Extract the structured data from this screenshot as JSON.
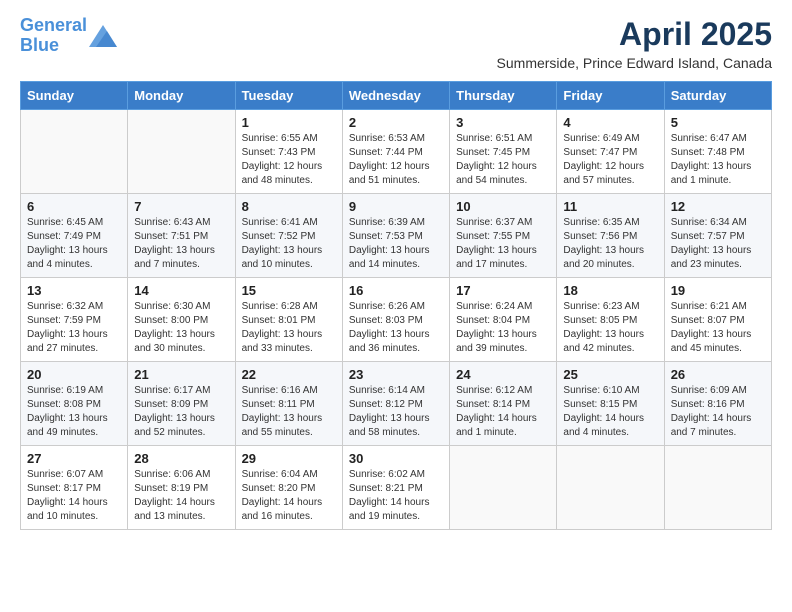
{
  "header": {
    "logo_line1": "General",
    "logo_line2": "Blue",
    "month_title": "April 2025",
    "subtitle": "Summerside, Prince Edward Island, Canada"
  },
  "days_of_week": [
    "Sunday",
    "Monday",
    "Tuesday",
    "Wednesday",
    "Thursday",
    "Friday",
    "Saturday"
  ],
  "weeks": [
    [
      {
        "day": "",
        "info": ""
      },
      {
        "day": "",
        "info": ""
      },
      {
        "day": "1",
        "info": "Sunrise: 6:55 AM\nSunset: 7:43 PM\nDaylight: 12 hours\nand 48 minutes."
      },
      {
        "day": "2",
        "info": "Sunrise: 6:53 AM\nSunset: 7:44 PM\nDaylight: 12 hours\nand 51 minutes."
      },
      {
        "day": "3",
        "info": "Sunrise: 6:51 AM\nSunset: 7:45 PM\nDaylight: 12 hours\nand 54 minutes."
      },
      {
        "day": "4",
        "info": "Sunrise: 6:49 AM\nSunset: 7:47 PM\nDaylight: 12 hours\nand 57 minutes."
      },
      {
        "day": "5",
        "info": "Sunrise: 6:47 AM\nSunset: 7:48 PM\nDaylight: 13 hours\nand 1 minute."
      }
    ],
    [
      {
        "day": "6",
        "info": "Sunrise: 6:45 AM\nSunset: 7:49 PM\nDaylight: 13 hours\nand 4 minutes."
      },
      {
        "day": "7",
        "info": "Sunrise: 6:43 AM\nSunset: 7:51 PM\nDaylight: 13 hours\nand 7 minutes."
      },
      {
        "day": "8",
        "info": "Sunrise: 6:41 AM\nSunset: 7:52 PM\nDaylight: 13 hours\nand 10 minutes."
      },
      {
        "day": "9",
        "info": "Sunrise: 6:39 AM\nSunset: 7:53 PM\nDaylight: 13 hours\nand 14 minutes."
      },
      {
        "day": "10",
        "info": "Sunrise: 6:37 AM\nSunset: 7:55 PM\nDaylight: 13 hours\nand 17 minutes."
      },
      {
        "day": "11",
        "info": "Sunrise: 6:35 AM\nSunset: 7:56 PM\nDaylight: 13 hours\nand 20 minutes."
      },
      {
        "day": "12",
        "info": "Sunrise: 6:34 AM\nSunset: 7:57 PM\nDaylight: 13 hours\nand 23 minutes."
      }
    ],
    [
      {
        "day": "13",
        "info": "Sunrise: 6:32 AM\nSunset: 7:59 PM\nDaylight: 13 hours\nand 27 minutes."
      },
      {
        "day": "14",
        "info": "Sunrise: 6:30 AM\nSunset: 8:00 PM\nDaylight: 13 hours\nand 30 minutes."
      },
      {
        "day": "15",
        "info": "Sunrise: 6:28 AM\nSunset: 8:01 PM\nDaylight: 13 hours\nand 33 minutes."
      },
      {
        "day": "16",
        "info": "Sunrise: 6:26 AM\nSunset: 8:03 PM\nDaylight: 13 hours\nand 36 minutes."
      },
      {
        "day": "17",
        "info": "Sunrise: 6:24 AM\nSunset: 8:04 PM\nDaylight: 13 hours\nand 39 minutes."
      },
      {
        "day": "18",
        "info": "Sunrise: 6:23 AM\nSunset: 8:05 PM\nDaylight: 13 hours\nand 42 minutes."
      },
      {
        "day": "19",
        "info": "Sunrise: 6:21 AM\nSunset: 8:07 PM\nDaylight: 13 hours\nand 45 minutes."
      }
    ],
    [
      {
        "day": "20",
        "info": "Sunrise: 6:19 AM\nSunset: 8:08 PM\nDaylight: 13 hours\nand 49 minutes."
      },
      {
        "day": "21",
        "info": "Sunrise: 6:17 AM\nSunset: 8:09 PM\nDaylight: 13 hours\nand 52 minutes."
      },
      {
        "day": "22",
        "info": "Sunrise: 6:16 AM\nSunset: 8:11 PM\nDaylight: 13 hours\nand 55 minutes."
      },
      {
        "day": "23",
        "info": "Sunrise: 6:14 AM\nSunset: 8:12 PM\nDaylight: 13 hours\nand 58 minutes."
      },
      {
        "day": "24",
        "info": "Sunrise: 6:12 AM\nSunset: 8:14 PM\nDaylight: 14 hours\nand 1 minute."
      },
      {
        "day": "25",
        "info": "Sunrise: 6:10 AM\nSunset: 8:15 PM\nDaylight: 14 hours\nand 4 minutes."
      },
      {
        "day": "26",
        "info": "Sunrise: 6:09 AM\nSunset: 8:16 PM\nDaylight: 14 hours\nand 7 minutes."
      }
    ],
    [
      {
        "day": "27",
        "info": "Sunrise: 6:07 AM\nSunset: 8:17 PM\nDaylight: 14 hours\nand 10 minutes."
      },
      {
        "day": "28",
        "info": "Sunrise: 6:06 AM\nSunset: 8:19 PM\nDaylight: 14 hours\nand 13 minutes."
      },
      {
        "day": "29",
        "info": "Sunrise: 6:04 AM\nSunset: 8:20 PM\nDaylight: 14 hours\nand 16 minutes."
      },
      {
        "day": "30",
        "info": "Sunrise: 6:02 AM\nSunset: 8:21 PM\nDaylight: 14 hours\nand 19 minutes."
      },
      {
        "day": "",
        "info": ""
      },
      {
        "day": "",
        "info": ""
      },
      {
        "day": "",
        "info": ""
      }
    ]
  ]
}
